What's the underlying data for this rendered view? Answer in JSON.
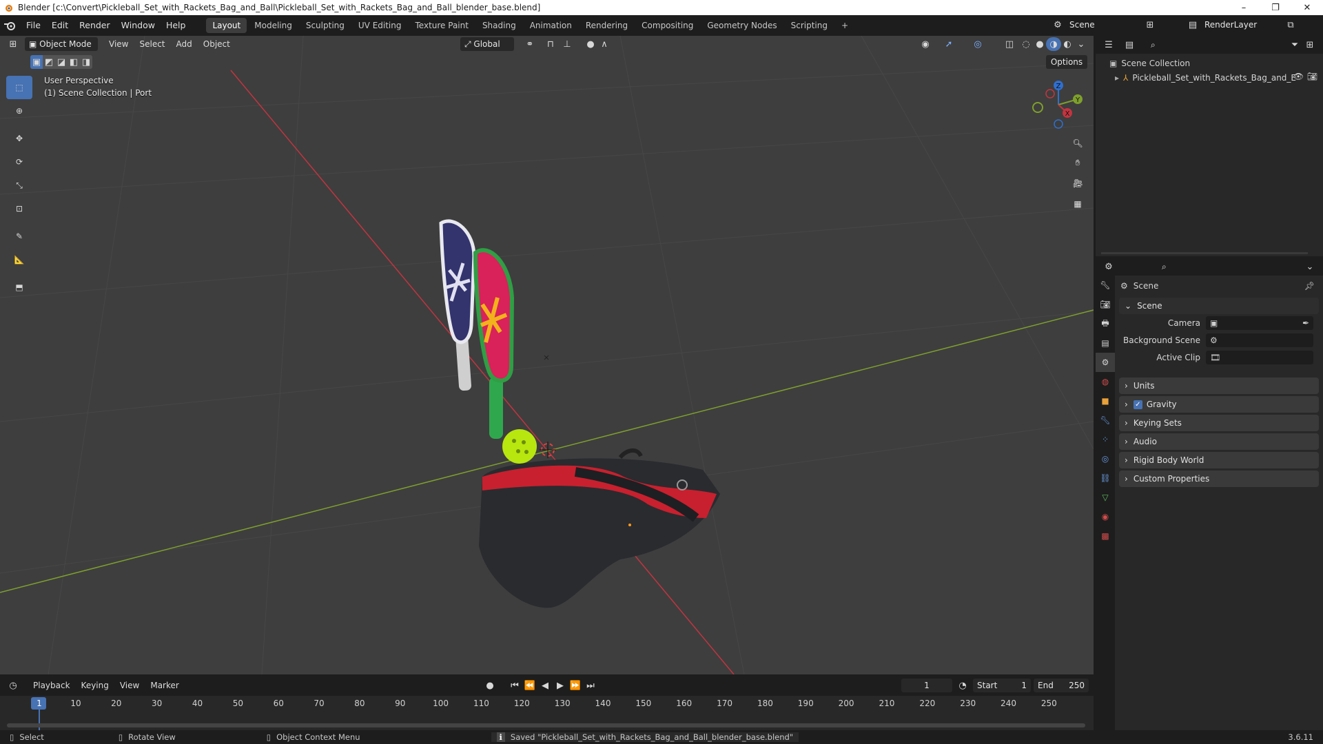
{
  "window": {
    "title": "Blender [c:\\Convert\\Pickleball_Set_with_Rackets_Bag_and_Ball\\Pickleball_Set_with_Rackets_Bag_and_Ball_blender_base.blend]",
    "controls": [
      "–",
      "❐",
      "✕"
    ]
  },
  "menu": {
    "items": [
      "File",
      "Edit",
      "Render",
      "Window",
      "Help"
    ]
  },
  "workspaces": {
    "tabs": [
      "Layout",
      "Modeling",
      "Sculpting",
      "UV Editing",
      "Texture Paint",
      "Shading",
      "Animation",
      "Rendering",
      "Compositing",
      "Geometry Nodes",
      "Scripting"
    ],
    "active": "Layout",
    "add_label": "+"
  },
  "scene_selector": {
    "label": "Scene"
  },
  "view_layer_selector": {
    "label": "RenderLayer"
  },
  "viewport": {
    "mode": "Object Mode",
    "menus": [
      "View",
      "Select",
      "Add",
      "Object"
    ],
    "orientation": "Global",
    "options_label": "Options",
    "overlay_title": "User Perspective",
    "overlay_subtitle": "(1) Scene Collection | Port",
    "gizmo": {
      "z": "Z",
      "y": "Y",
      "x": "X"
    }
  },
  "outliner": {
    "root": "Scene Collection",
    "items": [
      {
        "label": "Pickleball_Set_with_Rackets_Bag_and_E"
      }
    ]
  },
  "properties": {
    "context": "Scene",
    "panel_title": "Scene",
    "camera_label": "Camera",
    "background_scene_label": "Background Scene",
    "active_clip_label": "Active Clip",
    "collapsed_panels": [
      "Units",
      "Gravity",
      "Keying Sets",
      "Audio",
      "Rigid Body World",
      "Custom Properties"
    ],
    "gravity_checked": true
  },
  "timeline": {
    "menus": [
      "Playback",
      "Keying",
      "View",
      "Marker"
    ],
    "current_frame": "1",
    "start_label": "Start",
    "start_value": "1",
    "end_label": "End",
    "end_value": "250",
    "ticks": [
      "1",
      "10",
      "20",
      "30",
      "40",
      "50",
      "60",
      "70",
      "80",
      "90",
      "100",
      "110",
      "120",
      "130",
      "140",
      "150",
      "160",
      "170",
      "180",
      "190",
      "200",
      "210",
      "220",
      "230",
      "240",
      "250"
    ]
  },
  "status": {
    "select": "Select",
    "rotate": "Rotate View",
    "context_menu": "Object Context Menu",
    "message": "Saved \"Pickleball_Set_with_Rackets_Bag_and_Ball_blender_base.blend\"",
    "version": "3.6.11"
  },
  "colors": {
    "accent": "#4772b3",
    "x_axis": "#c4343f",
    "y_axis": "#7ea02c",
    "viewport_bg": "#3e3e3e"
  }
}
